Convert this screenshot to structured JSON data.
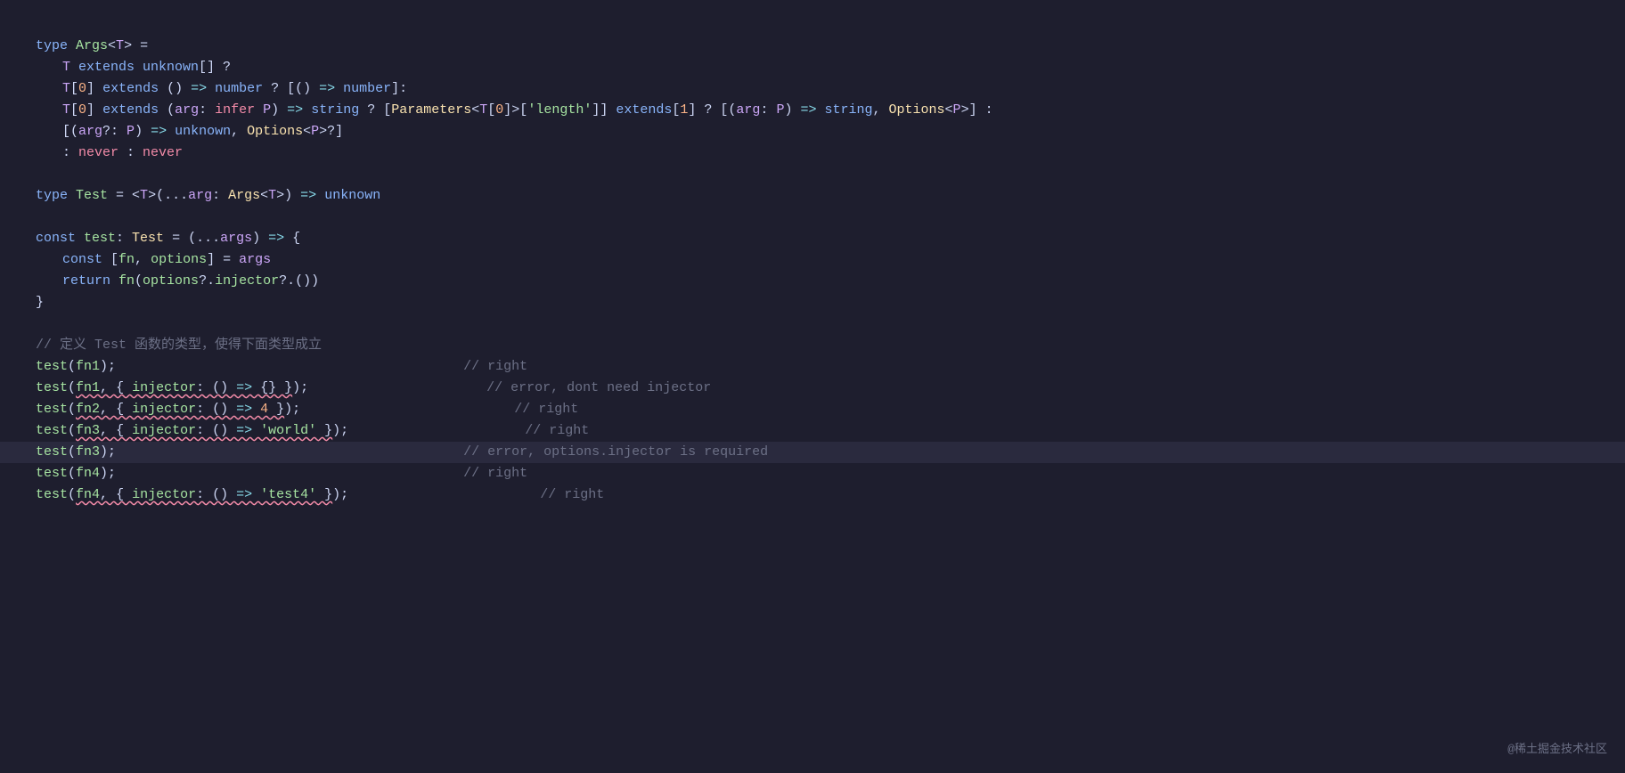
{
  "watermark": "@稀土掘金技术社区",
  "lines": [
    {
      "id": "l1",
      "content": "type Args<T> ="
    },
    {
      "id": "l2",
      "content": "  T extends unknown[] ?",
      "indent": 1
    },
    {
      "id": "l3",
      "content": "  T[0] extends () => number ? [() => number]:",
      "indent": 1
    },
    {
      "id": "l4",
      "content": "  T[0] extends (arg: infer P) => string ? [Parameters<T[0]>['length']] extends[1] ? [(arg: P) => string, Options<P>] :",
      "indent": 1
    },
    {
      "id": "l5",
      "content": "  [(arg?: P) => unknown, Options<P>?]",
      "indent": 1
    },
    {
      "id": "l6",
      "content": "  : never  : never",
      "indent": 1
    },
    {
      "id": "l7",
      "content": ""
    },
    {
      "id": "l8",
      "content": "type Test = <T>(...arg: Args<T>) => unknown"
    },
    {
      "id": "l9",
      "content": ""
    },
    {
      "id": "l10",
      "content": "const test: Test = (...args) => {"
    },
    {
      "id": "l11",
      "content": "  const [fn, options] = args",
      "indent": 1
    },
    {
      "id": "l12",
      "content": "  return fn(options?.injector?.())",
      "indent": 1
    },
    {
      "id": "l13",
      "content": "}"
    },
    {
      "id": "l14",
      "content": ""
    },
    {
      "id": "l15",
      "content": "// 定义 Test 函数的类型，使得下面类型成立"
    },
    {
      "id": "l16",
      "content": "test(fn1);                                      // right"
    },
    {
      "id": "l17",
      "content": "test(fn1, { injector: () => {} });              // error, dont need injector",
      "error": true
    },
    {
      "id": "l18",
      "content": "test(fn2, { injector: () => 4 });               // right",
      "error": true
    },
    {
      "id": "l19",
      "content": "test(fn3, { injector: () => 'world' });         // right",
      "error": true
    },
    {
      "id": "l20",
      "content": "test(fn3);                                      // error, options.injector is required",
      "highlight": true
    },
    {
      "id": "l21",
      "content": "test(fn4);                                      // right"
    },
    {
      "id": "l22",
      "content": "test(fn4, { injector: () => 'test4' });         // right",
      "error": true
    }
  ]
}
